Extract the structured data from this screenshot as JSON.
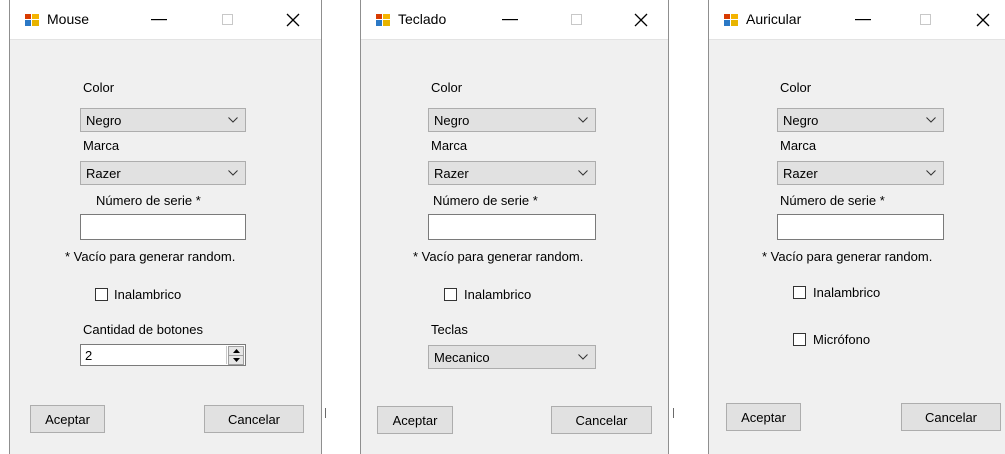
{
  "colors": {
    "window_bg": "#f0f0f0",
    "titlebar_bg": "#ffffff",
    "button_bg": "#e1e1e1",
    "border": "#adadad"
  },
  "windows": [
    {
      "title": "Mouse",
      "color_label": "Color",
      "color_value": "Negro",
      "brand_label": "Marca",
      "brand_value": "Razer",
      "serial_label": "Número de serie *",
      "serial_value": "",
      "hint": "* Vacío para generar random.",
      "wireless_label": "Inalambrico",
      "wireless_checked": false,
      "buttons_count_label": "Cantidad de botones",
      "buttons_count_value": "2",
      "accept_label": "Aceptar",
      "cancel_label": "Cancelar"
    },
    {
      "title": "Teclado",
      "color_label": "Color",
      "color_value": "Negro",
      "brand_label": "Marca",
      "brand_value": "Razer",
      "serial_label": "Número de serie *",
      "serial_value": "",
      "hint": "* Vacío para generar random.",
      "wireless_label": "Inalambrico",
      "wireless_checked": false,
      "keys_label": "Teclas",
      "keys_value": "Mecanico",
      "accept_label": "Aceptar",
      "cancel_label": "Cancelar"
    },
    {
      "title": "Auricular",
      "color_label": "Color",
      "color_value": "Negro",
      "brand_label": "Marca",
      "brand_value": "Razer",
      "serial_label": "Número de serie *",
      "serial_value": "",
      "hint": "* Vacío para generar random.",
      "wireless_label": "Inalambrico",
      "wireless_checked": false,
      "microphone_label": "Micrófono",
      "microphone_checked": false,
      "accept_label": "Aceptar",
      "cancel_label": "Cancelar"
    }
  ]
}
